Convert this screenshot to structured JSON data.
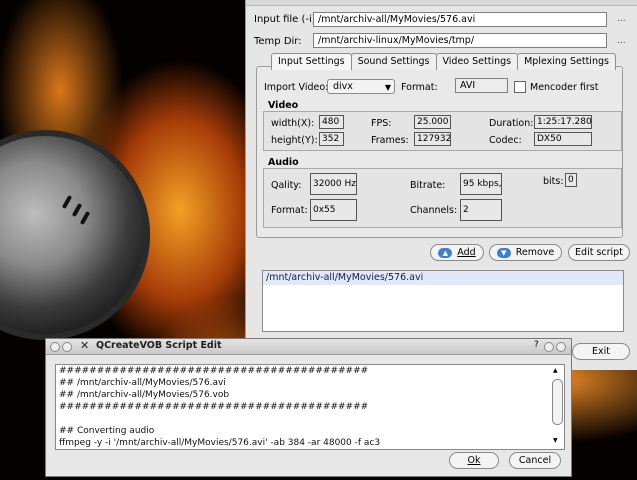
{
  "main": {
    "input_file_label": "Input file (-i)",
    "input_file_value": "/mnt/archiv-all/MyMovies/576.avi",
    "temp_dir_label": "Temp Dir:",
    "temp_dir_value": "/mnt/archiv-linux/MyMovies/tmp/",
    "browse": "...",
    "tabs": [
      "Input Settings",
      "Sound Settings",
      "Video Settings",
      "Mplexing Settings"
    ],
    "import_video_label": "Import Video:",
    "import_video_value": "divx",
    "format_label": "Format:",
    "format_value": "AVI",
    "mencoder_label": "Mencoder first",
    "video": {
      "title": "Video",
      "width_label": "width(X):",
      "width_value": "480",
      "height_label": "height(Y):",
      "height_value": "352",
      "fps_label": "FPS:",
      "fps_value": "25.000",
      "frames_label": "Frames:",
      "frames_value": "127932",
      "duration_label": "Duration:",
      "duration_value": "1:25:17.280",
      "codec_label": "Codec:",
      "codec_value": "DX50"
    },
    "audio": {
      "title": "Audio",
      "quality_label": "Qality:",
      "quality_value": "32000 Hz",
      "bitrate_label": "Bitrate:",
      "bitrate_value": "95 kbps,",
      "bits_label": "bits:",
      "bits_value": "0",
      "format_label": "Format:",
      "format_value": "0x55",
      "channels_label": "Channels:",
      "channels_value": "2"
    },
    "add_label": "Add",
    "remove_label": "Remove",
    "edit_script_label": "Edit script",
    "list_items": [
      "/mnt/archiv-all/MyMovies/576.avi"
    ],
    "exit_label": "Exit"
  },
  "script_window": {
    "title": "QCreateVOB Script Edit",
    "help": "?",
    "lines": [
      "#########################################",
      "## /mnt/archiv-all/MyMovies/576.avi",
      "## /mnt/archiv-all/MyMovies/576.vob",
      "#########################################",
      "",
      "## Converting audio",
      "ffmpeg -y -i '/mnt/archiv-all/MyMovies/576.avi' -ab 384 -ar 48000 -f ac3"
    ],
    "ok_label": "Ok",
    "cancel_label": "Cancel"
  }
}
